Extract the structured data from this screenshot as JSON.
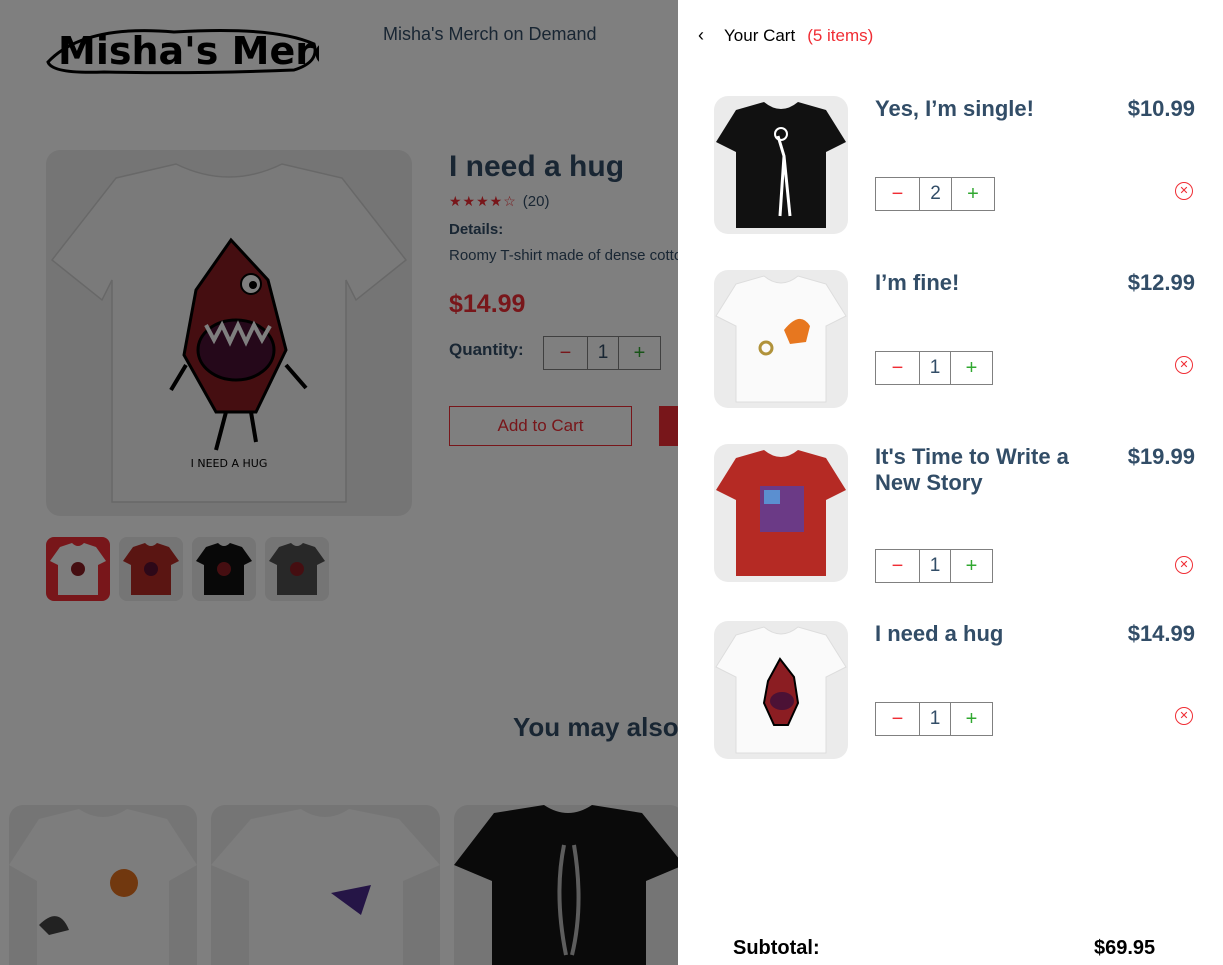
{
  "header": {
    "logo_text": "Misha's Merch",
    "tagline": "Misha's Merch on Demand"
  },
  "product": {
    "title": "I need a hug",
    "stars": "★★★★☆",
    "review_count": "(20)",
    "details_label": "Details:",
    "details_text": "Roomy T-shirt made of dense cotton",
    "price": "$14.99",
    "quantity_label": "Quantity:",
    "quantity": "1",
    "minus": "−",
    "plus": "+",
    "add_to_cart": "Add to Cart",
    "shirt_caption": "I NEED A HUG",
    "thumbnails": [
      "white",
      "red",
      "black",
      "grey"
    ]
  },
  "recommendations": {
    "heading": "You may also like"
  },
  "cart": {
    "back_icon": "‹",
    "title": "Your Cart",
    "count": "(5 items)",
    "items": [
      {
        "name": "Yes, I’m single!",
        "price": "$10.99",
        "quantity": "2",
        "shirt_color": "#111111",
        "minus": "−",
        "plus": "+",
        "remove": "✕"
      },
      {
        "name": "I’m fine!",
        "price": "$12.99",
        "quantity": "1",
        "shirt_color": "#fafafa",
        "minus": "−",
        "plus": "+",
        "remove": "✕"
      },
      {
        "name": "It's Time to Write a New Story",
        "price": "$19.99",
        "quantity": "1",
        "shirt_color": "#b52a24",
        "minus": "−",
        "plus": "+",
        "remove": "✕"
      },
      {
        "name": "I need a hug",
        "price": "$14.99",
        "quantity": "1",
        "shirt_color": "#fafafa",
        "minus": "−",
        "plus": "+",
        "remove": "✕"
      }
    ],
    "subtotal_label": "Subtotal:",
    "subtotal_value": "$69.95"
  },
  "colors": {
    "accent": "#f02d34",
    "text": "#324d67",
    "plus": "#31a831"
  }
}
